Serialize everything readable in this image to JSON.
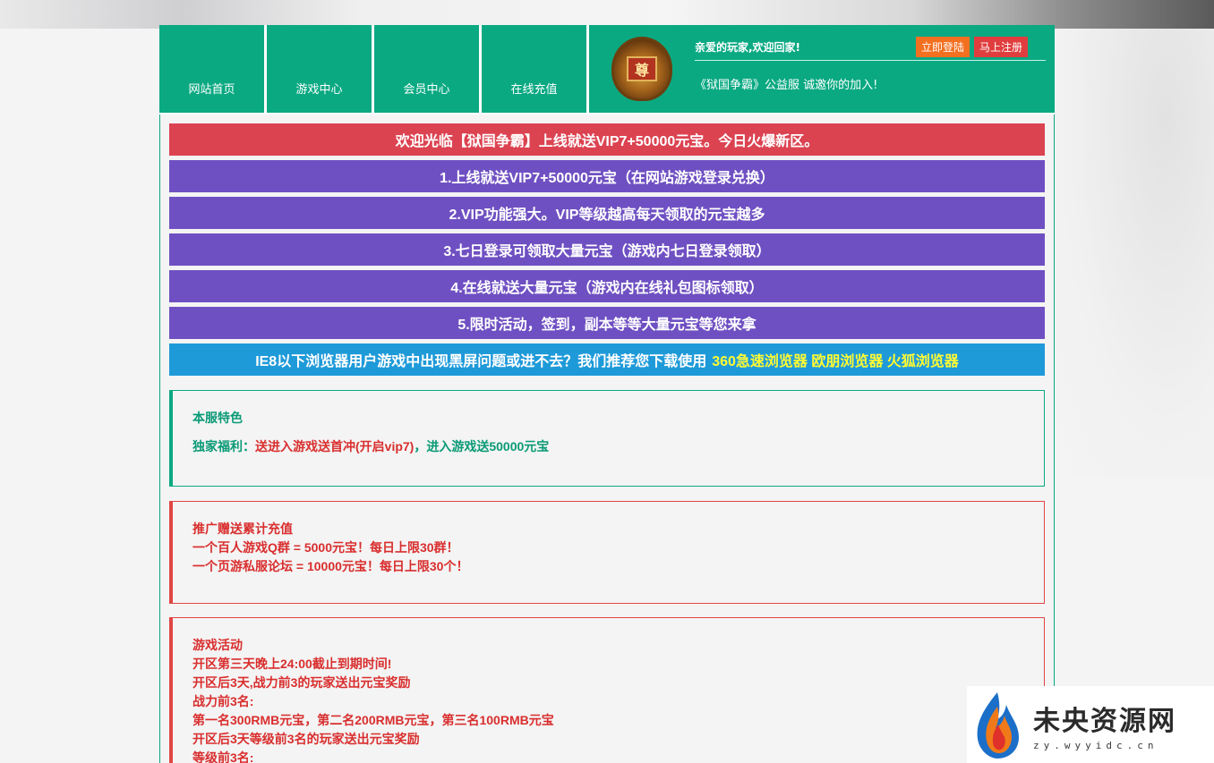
{
  "nav": {
    "items": [
      {
        "label": "网站首页"
      },
      {
        "label": "游戏中心"
      },
      {
        "label": "会员中心"
      },
      {
        "label": "在线充值"
      }
    ],
    "emblem_glyph": "尊",
    "welcome": "亲爱的玩家,欢迎回家!",
    "login_label": "立即登陆",
    "register_label": "马上注册",
    "slogan": "《狱国争霸》公益服 诚邀你的加入!"
  },
  "banners": {
    "b0": "欢迎光临【狱国争霸】上线就送VIP7+50000元宝。今日火爆新区。",
    "b1": "1.上线就送VIP7+50000元宝（在网站游戏登录兑换）",
    "b2": "2.VIP功能强大。VIP等级越高每天领取的元宝越多",
    "b3": "3.七日登录可领取大量元宝（游戏内七日登录领取）",
    "b4": "4.在线就送大量元宝（游戏内在线礼包图标领取）",
    "b5": "5.限时活动，签到，副本等等大量元宝等您来拿",
    "browser_text": "IE8以下浏览器用户游戏中出现黑屏问题或进不去？我们推荐您下载使用",
    "browser_links": "360急速浏览器 欧朋浏览器 火狐浏览器"
  },
  "features": {
    "title": "本服特色",
    "prefix": "独家福利：",
    "highlight": "送进入游戏送首冲(开启vip7)",
    "suffix": "，进入游戏送50000元宝"
  },
  "promo": {
    "lines": [
      "推广赠送累计充值",
      "一个百人游戏Q群 = 5000元宝！每日上限30群！",
      "一个页游私服论坛 = 10000元宝！每日上限30个！"
    ]
  },
  "events": {
    "lines": [
      "游戏活动",
      "开区第三天晚上24:00截止到期时间!",
      "开区后3天,战力前3的玩家送出元宝奖励",
      "战力前3名:",
      "第一名300RMB元宝，第二名200RMB元宝，第三名100RMB元宝",
      "开区后3天等级前3名的玩家送出元宝奖励",
      "等级前3名:"
    ]
  },
  "watermark": {
    "title": "未央资源网",
    "url": "zy.wyyidc.cn"
  },
  "colors": {
    "nav_green": "#0aa982",
    "banner_red": "#dc4351",
    "banner_purple": "#6f50c2",
    "banner_blue": "#1e9ad9",
    "highlight_yellow": "#fffb32"
  }
}
